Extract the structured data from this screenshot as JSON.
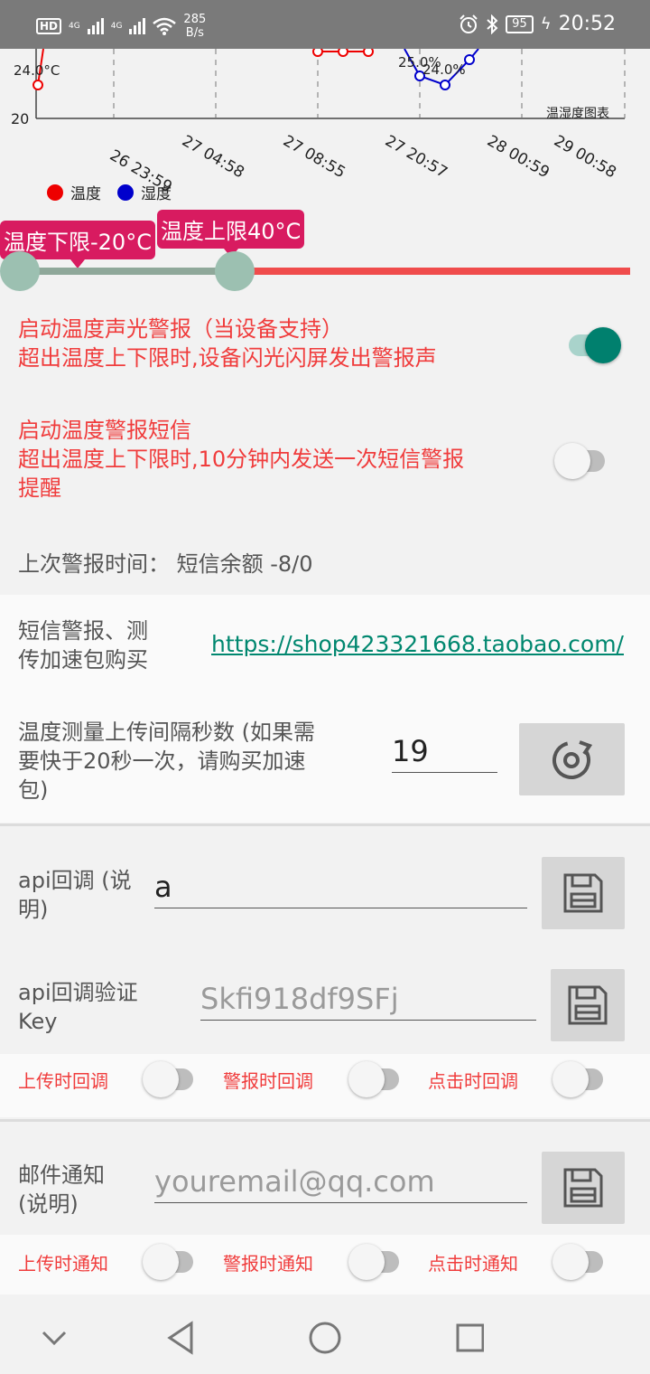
{
  "status_bar": {
    "hd": "HD",
    "sig1": "4G",
    "sig2": "4G",
    "net_speed": "285",
    "net_unit": "B/s",
    "battery": "95",
    "time": "20:52"
  },
  "chart_data": {
    "type": "line",
    "y_tick": "20",
    "corner_label": "温湿度图表",
    "x_ticks": [
      "26 23:59",
      "27 04:58",
      "27 08:55",
      "27 20:57",
      "28 00:59",
      "29 00:58"
    ],
    "series": [
      {
        "name": "温度",
        "color": "#ff0000",
        "visible_points_labels": [
          "24.0°C"
        ]
      },
      {
        "name": "湿度",
        "color": "#0000cc",
        "visible_points_labels": [
          "25.0%",
          "24.0%"
        ]
      }
    ]
  },
  "legend": {
    "temp": "温度",
    "hum": "湿度"
  },
  "range": {
    "low_label": "温度下限-20°C",
    "high_label": "温度上限40°C",
    "low_value": -20,
    "high_value": 40
  },
  "alarm_sound": {
    "title": "启动温度声光警报（当设备支持）",
    "desc": "超出温度上下限时,设备闪光闪屏发出警报声",
    "enabled": true
  },
  "alarm_sms": {
    "title": "启动温度警报短信",
    "desc": "超出温度上下限时,10分钟内发送一次短信警报",
    "desc2": "提醒",
    "enabled": false
  },
  "last_alarm": "上次警报时间：  短信余额 -8/0",
  "purchase": {
    "label1": "短信警报、测",
    "label2": "传加速包购买",
    "link": "https://shop423321668.taobao.com/"
  },
  "interval": {
    "label1": "温度测量上传间隔秒数 (如果需",
    "label2": "要快于20秒一次，请购买加速",
    "label3": "包)",
    "value": "19"
  },
  "api": {
    "label1": "api回调 (说",
    "label2": "明)",
    "value": "a",
    "key_label1": "api回调验证",
    "key_label2": "Key",
    "key_placeholder": "Skfi918df9SFj",
    "opts": [
      "上传时回调",
      "警报时回调",
      "点击时回调"
    ]
  },
  "email": {
    "label1": "邮件通知",
    "label2": "(说明)",
    "placeholder": "youremail@qq.com",
    "opts": [
      "上传时通知",
      "警报时通知",
      "点击时通知"
    ]
  }
}
